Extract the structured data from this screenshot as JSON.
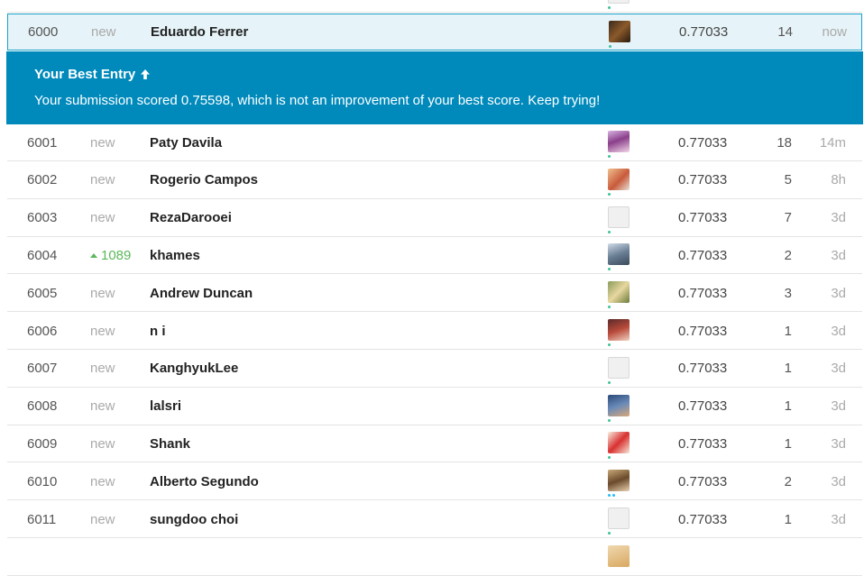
{
  "rows": [
    {
      "rank": "",
      "change": "",
      "name": "",
      "score": "",
      "entries": "",
      "last": "",
      "avatar": "av-grey",
      "dots": [
        "green"
      ]
    },
    {
      "rank": "6000",
      "change": "new",
      "name": "Eduardo Ferrer",
      "score": "0.77033",
      "entries": "14",
      "last": "now",
      "avatar": "av-dark",
      "dots": [
        "green"
      ]
    },
    {
      "rank": "6001",
      "change": "new",
      "name": "Paty Davila",
      "score": "0.77033",
      "entries": "18",
      "last": "14m",
      "avatar": "av-purple",
      "dots": [
        "green"
      ]
    },
    {
      "rank": "6002",
      "change": "new",
      "name": "Rogerio Campos",
      "score": "0.77033",
      "entries": "5",
      "last": "8h",
      "avatar": "av-warm",
      "dots": [
        "green"
      ]
    },
    {
      "rank": "6003",
      "change": "new",
      "name": "RezaDarooei",
      "score": "0.77033",
      "entries": "7",
      "last": "3d",
      "avatar": "av-grey",
      "dots": [
        "green"
      ]
    },
    {
      "rank": "6004",
      "change": "1089",
      "change_up": true,
      "name": "khames",
      "score": "0.77033",
      "entries": "2",
      "last": "3d",
      "avatar": "av-office",
      "dots": [
        "green"
      ]
    },
    {
      "rank": "6005",
      "change": "new",
      "name": "Andrew Duncan",
      "score": "0.77033",
      "entries": "3",
      "last": "3d",
      "avatar": "av-dog",
      "dots": [
        "green"
      ]
    },
    {
      "rank": "6006",
      "change": "new",
      "name": "n i",
      "score": "0.77033",
      "entries": "1",
      "last": "3d",
      "avatar": "av-red",
      "dots": [
        "green"
      ]
    },
    {
      "rank": "6007",
      "change": "new",
      "name": "KanghyukLee",
      "score": "0.77033",
      "entries": "1",
      "last": "3d",
      "avatar": "av-grey",
      "dots": [
        "green"
      ]
    },
    {
      "rank": "6008",
      "change": "new",
      "name": "lalsri",
      "score": "0.77033",
      "entries": "1",
      "last": "3d",
      "avatar": "av-blue",
      "dots": [
        "green"
      ]
    },
    {
      "rank": "6009",
      "change": "new",
      "name": "Shank",
      "score": "0.77033",
      "entries": "1",
      "last": "3d",
      "avatar": "av-flag",
      "dots": [
        "green"
      ]
    },
    {
      "rank": "6010",
      "change": "new",
      "name": "Alberto Segundo",
      "score": "0.77033",
      "entries": "2",
      "last": "3d",
      "avatar": "av-beard",
      "dots": [
        "blue",
        "blue"
      ]
    },
    {
      "rank": "6011",
      "change": "new",
      "name": "sungdoo choi",
      "score": "0.77033",
      "entries": "1",
      "last": "3d",
      "avatar": "av-grey",
      "dots": [
        "green"
      ]
    },
    {
      "rank": "",
      "change": "",
      "name": "",
      "score": "",
      "entries": "",
      "last": "",
      "avatar": "av-tan",
      "dots": []
    }
  ],
  "banner": {
    "title": "Your Best Entry",
    "message": "Your submission scored 0.75598, which is not an improvement of your best score. Keep trying!"
  },
  "colors": {
    "banner_bg": "#008abc",
    "highlight_border": "#1aa1c9",
    "highlight_bg": "#e6f3f8",
    "rank_up": "#5cb85c",
    "tier_dot_green": "#3cc39a",
    "tier_dot_blue": "#20beff"
  }
}
